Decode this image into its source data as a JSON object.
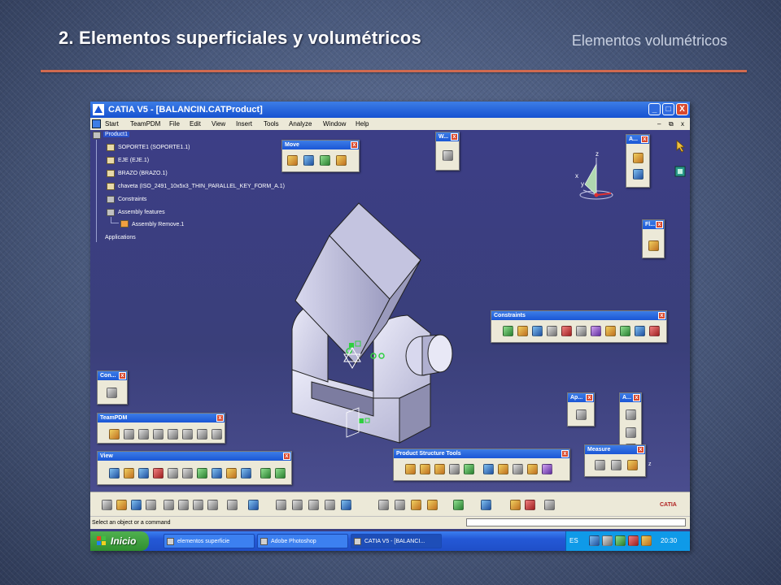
{
  "slide": {
    "title": "2. Elementos superficiales y volumétricos",
    "subtitle": "Elementos volumétricos"
  },
  "window": {
    "title": "CATIA V5 - [BALANCIN.CATProduct]",
    "min": "_",
    "max": "□",
    "close": "X",
    "doc_restore": "⧉",
    "doc_close": "x",
    "doc_min": "–"
  },
  "menu": [
    "Start",
    "TeamPDM",
    "File",
    "Edit",
    "View",
    "Insert",
    "Tools",
    "Analyze",
    "Window",
    "Help"
  ],
  "tree": {
    "root": "Product1",
    "items": [
      "SOPORTE1 (SOPORTE1.1)",
      "EJE (EJE.1)",
      "BRAZO (BRAZO.1)",
      "chaveta (ISO_2491_10x5x3_THIN_PARALLEL_KEY_FORM_A.1)",
      "Constraints",
      "Assembly features",
      "Assembly Remove.1",
      "Applications"
    ]
  },
  "toolbars": {
    "move": "Move",
    "w": "W...",
    "a1": "A...",
    "fl": "Fl...",
    "constraints": "Constraints",
    "con": "Con...",
    "teampdm": "TeamPDM",
    "view": "View",
    "product_structure": "Product Structure Tools",
    "ap": "Ap...",
    "a2": "A...",
    "measure": "Measure",
    "close_glyph": "x"
  },
  "compass": {
    "x": "x",
    "y": "y",
    "z": "z"
  },
  "small_axis": "z",
  "catia_logo": "CATIA",
  "status": {
    "prompt": "Select an object or a command"
  },
  "taskbar": {
    "start": "Inicio",
    "buttons": [
      "elementos superficie",
      "Adobe Photoshop",
      "CATIA V5 - [BALANCI..."
    ],
    "lang": "ES",
    "time": "20:30"
  },
  "colors": {
    "viewport": "#3c3e86",
    "title_rule": "#d06a50",
    "part_light": "#dcdcf0",
    "part_dark": "#8e8eb0"
  }
}
